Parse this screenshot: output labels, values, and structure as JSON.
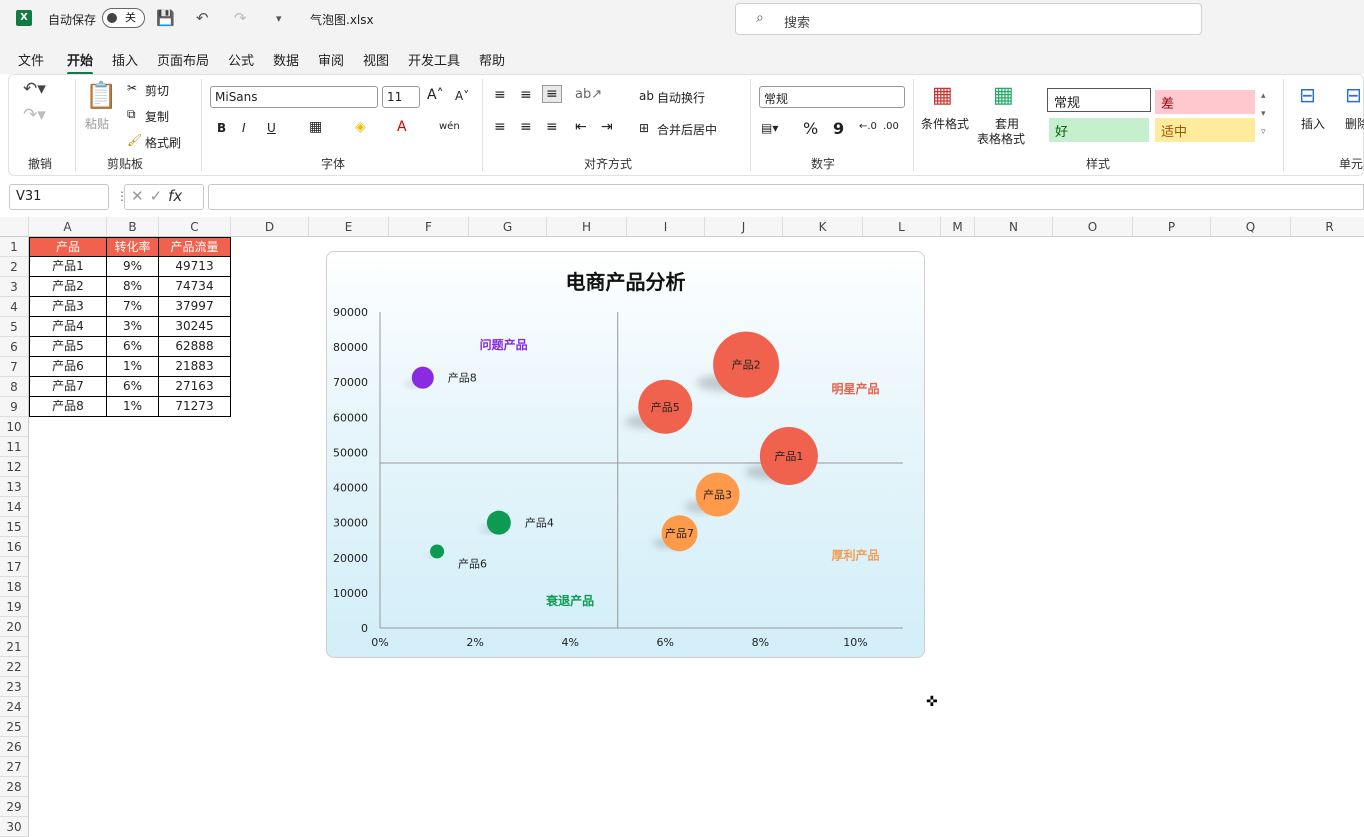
{
  "titlebar": {
    "logo": "X",
    "autosave_label": "自动保存",
    "autosave_state": "关",
    "filename": "气泡图.xlsx",
    "search_placeholder": "搜索"
  },
  "menu": [
    "文件",
    "开始",
    "插入",
    "页面布局",
    "公式",
    "数据",
    "审阅",
    "视图",
    "开发工具",
    "帮助"
  ],
  "menu_active": "开始",
  "ribbon": {
    "undo_group": "撤销",
    "clipboard": {
      "paste": "粘贴",
      "cut": "剪切",
      "copy": "复制",
      "format_painter": "格式刷",
      "label": "剪贴板"
    },
    "font": {
      "name": "MiSans",
      "size": "11",
      "bold": "B",
      "italic": "I",
      "underline": "U",
      "label": "字体"
    },
    "alignment": {
      "wrap": "自动换行",
      "merge": "合并后居中",
      "label": "对齐方式"
    },
    "number": {
      "format": "常规",
      "percent": "%",
      "comma": "9",
      "label": "数字"
    },
    "styles": {
      "conditional": "条件格式",
      "table_format_1": "套用",
      "table_format_2": "表格格式",
      "normal": "常规",
      "bad": "差",
      "good": "好",
      "neutral": "适中",
      "label": "样式"
    },
    "cells": {
      "insert": "插入",
      "delete": "删除",
      "label": "单元"
    }
  },
  "formula_bar": {
    "namebox": "V31",
    "fx": "fx",
    "value": ""
  },
  "columns": [
    "A",
    "B",
    "C",
    "D",
    "E",
    "F",
    "G",
    "H",
    "I",
    "J",
    "K",
    "L",
    "M",
    "N",
    "O",
    "P",
    "Q",
    "R"
  ],
  "rows": [
    "1",
    "2",
    "3",
    "4",
    "5",
    "6",
    "7",
    "8",
    "9",
    "10",
    "11",
    "12",
    "13",
    "14",
    "15",
    "16",
    "17",
    "18",
    "19",
    "20",
    "21",
    "22",
    "23",
    "24",
    "25",
    "26",
    "27",
    "28",
    "29",
    "30"
  ],
  "table": {
    "headers": [
      "产品",
      "转化率",
      "产品流量"
    ],
    "rows": [
      [
        "产品1",
        "9%",
        "49713"
      ],
      [
        "产品2",
        "8%",
        "74734"
      ],
      [
        "产品3",
        "7%",
        "37997"
      ],
      [
        "产品4",
        "3%",
        "30245"
      ],
      [
        "产品5",
        "6%",
        "62888"
      ],
      [
        "产品6",
        "1%",
        "21883"
      ],
      [
        "产品7",
        "6%",
        "27163"
      ],
      [
        "产品8",
        "1%",
        "71273"
      ]
    ]
  },
  "chart_data": {
    "type": "scatter",
    "title": "电商产品分析",
    "xlim": [
      0,
      0.11
    ],
    "ylim": [
      0,
      90000
    ],
    "x_ticks": [
      "0%",
      "2%",
      "4%",
      "6%",
      "8%",
      "10%"
    ],
    "y_ticks": [
      "0",
      "10000",
      "20000",
      "30000",
      "40000",
      "50000",
      "60000",
      "70000",
      "80000",
      "90000"
    ],
    "divider_x": 0.05,
    "divider_y": 47000,
    "points": [
      {
        "label": "产品1",
        "x": 0.086,
        "y": 49000,
        "r": 29,
        "color": "#f0624d"
      },
      {
        "label": "产品2",
        "x": 0.077,
        "y": 75000,
        "r": 33,
        "color": "#f0624d"
      },
      {
        "label": "产品3",
        "x": 0.071,
        "y": 38000,
        "r": 22,
        "color": "#ff9a4a"
      },
      {
        "label": "产品4",
        "x": 0.025,
        "y": 30000,
        "r": 12,
        "color": "#0d9a52"
      },
      {
        "label": "产品5",
        "x": 0.06,
        "y": 63000,
        "r": 27,
        "color": "#f0624d"
      },
      {
        "label": "产品6",
        "x": 0.012,
        "y": 21800,
        "r": 7,
        "color": "#0d9a52"
      },
      {
        "label": "产品7",
        "x": 0.063,
        "y": 27000,
        "r": 18,
        "color": "#ff9a4a"
      },
      {
        "label": "产品8",
        "x": 0.009,
        "y": 71300,
        "r": 11,
        "color": "#8a2be2"
      }
    ],
    "quadrants": [
      {
        "text": "问题产品",
        "x": 0.026,
        "y": 79500,
        "color": "#8a2be2"
      },
      {
        "text": "明星产品",
        "x": 0.1,
        "y": 67000,
        "color": "#e8634a"
      },
      {
        "text": "厚利产品",
        "x": 0.1,
        "y": 19500,
        "color": "#f0a05a"
      },
      {
        "text": "衰退产品",
        "x": 0.04,
        "y": 6500,
        "color": "#0d9a52"
      }
    ]
  }
}
